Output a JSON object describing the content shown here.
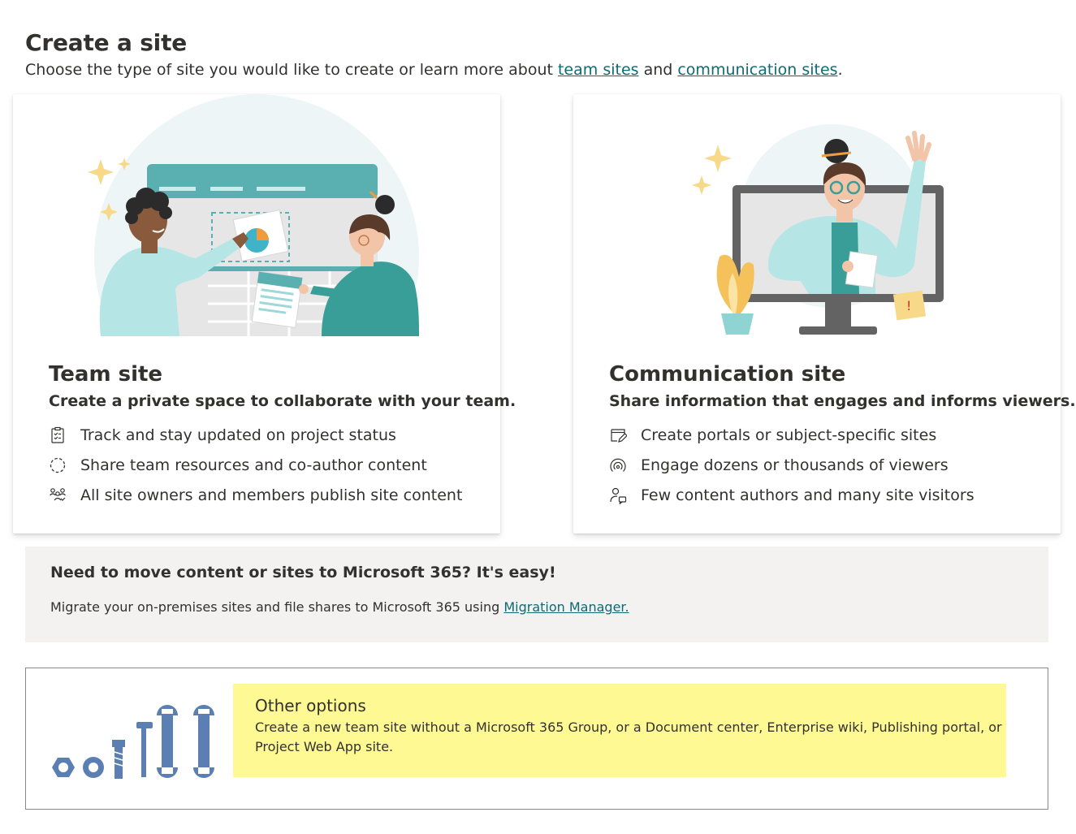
{
  "header": {
    "title": "Create a site",
    "subtitle_prefix": "Choose the type of site you would like to create or learn more about ",
    "team_sites_link": "team sites",
    "subtitle_and": " and ",
    "communication_sites_link": "communication sites",
    "subtitle_suffix": "."
  },
  "cards": {
    "team": {
      "title": "Team site",
      "description": "Create a private space to collaborate with your team.",
      "features": [
        {
          "icon": "clipboard-checklist-icon",
          "text": "Track and stay updated on project status"
        },
        {
          "icon": "sync-circle-icon",
          "text": "Share team resources and co-author content"
        },
        {
          "icon": "people-group-icon",
          "text": "All site owners and members publish site content"
        }
      ]
    },
    "communication": {
      "title": "Communication site",
      "description": "Share information that engages and informs viewers.",
      "features": [
        {
          "icon": "page-edit-icon",
          "text": "Create portals or subject-specific sites"
        },
        {
          "icon": "broadcast-icon",
          "text": "Engage dozens or thousands of viewers"
        },
        {
          "icon": "person-feedback-icon",
          "text": "Few content authors and many site visitors"
        }
      ]
    }
  },
  "migration": {
    "title": "Need to move content or sites to Microsoft 365? It's easy!",
    "text_prefix": "Migrate your on-premises sites and file shares to Microsoft 365 using ",
    "link": "Migration Manager."
  },
  "other_options": {
    "title": "Other options",
    "description": "Create a new team site without a Microsoft 365 Group, or a Document center, Enterprise wiki, Publishing portal, or Project Web App site."
  },
  "colors": {
    "link": "#0f6a72",
    "teal": "#5aafb0",
    "highlight": "#fff993",
    "panel": "#f3f2f1",
    "tool_blue": "#5b7fb3"
  }
}
